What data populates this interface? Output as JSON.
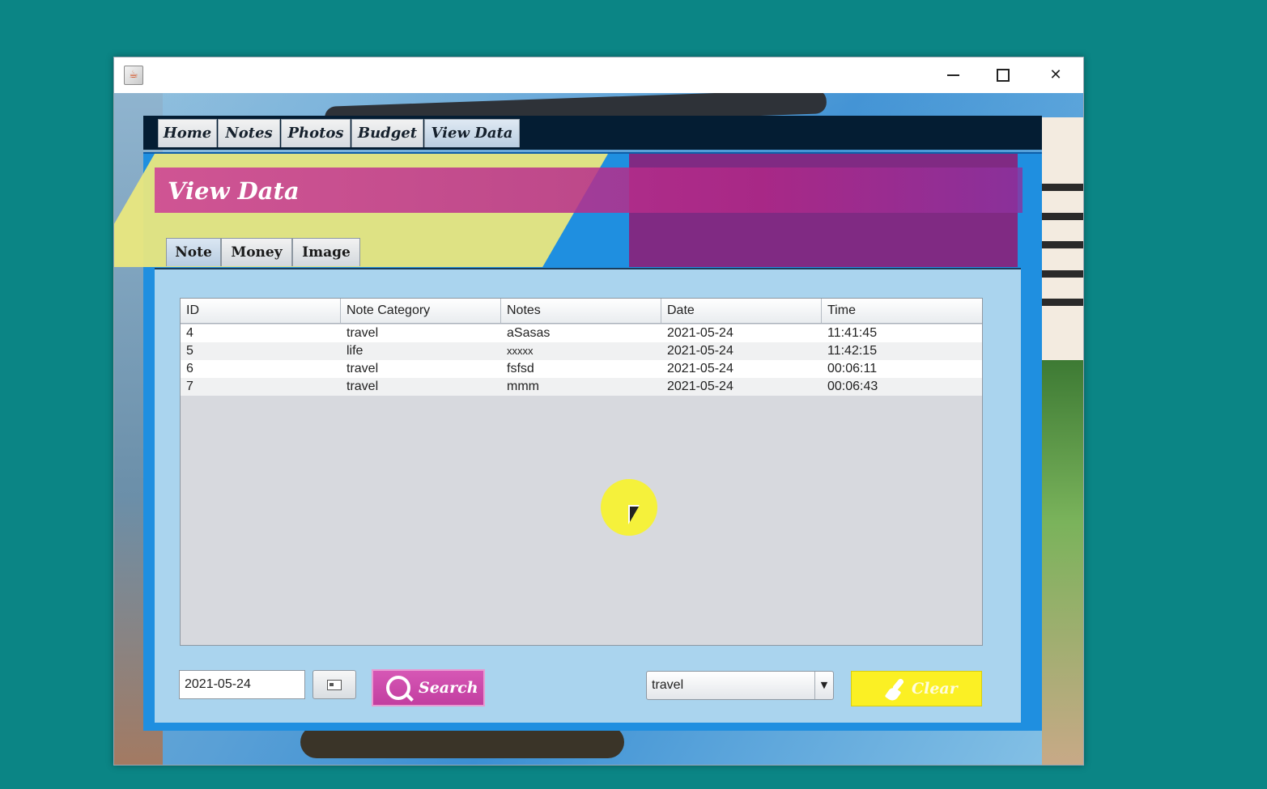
{
  "window": {
    "icon": "java-app-icon",
    "controls": {
      "minimize": "minimize-icon",
      "maximize": "maximize-icon",
      "close": "close-icon"
    }
  },
  "nav": {
    "tabs": [
      "Home",
      "Notes",
      "Photos",
      "Budget",
      "View Data"
    ],
    "active": "View Data"
  },
  "page": {
    "title": "View Data"
  },
  "subtabs": {
    "items": [
      "Note",
      "Money",
      "Image"
    ],
    "active": "Note"
  },
  "table": {
    "columns": [
      "ID",
      "Note Category",
      "Notes",
      "Date",
      "Time"
    ],
    "rows": [
      [
        "4",
        "travel",
        "aSasas",
        "2021-05-24",
        "11:41:45"
      ],
      [
        "5",
        "life",
        "xxxxx",
        "2021-05-24",
        "11:42:15"
      ],
      [
        "6",
        "travel",
        "fsfsd",
        "2021-05-24",
        "00:06:11"
      ],
      [
        "7",
        "travel",
        "mmm",
        "2021-05-24",
        "00:06:43"
      ]
    ]
  },
  "controls": {
    "date_value": "2021-05-24",
    "search_label": "Search",
    "category_value": "travel",
    "clear_label": "Clear"
  },
  "colors": {
    "desktop": "#0b8585",
    "nav_bar": "#041d33",
    "search_button": "#c23ea0",
    "clear_button": "#fbf024"
  }
}
